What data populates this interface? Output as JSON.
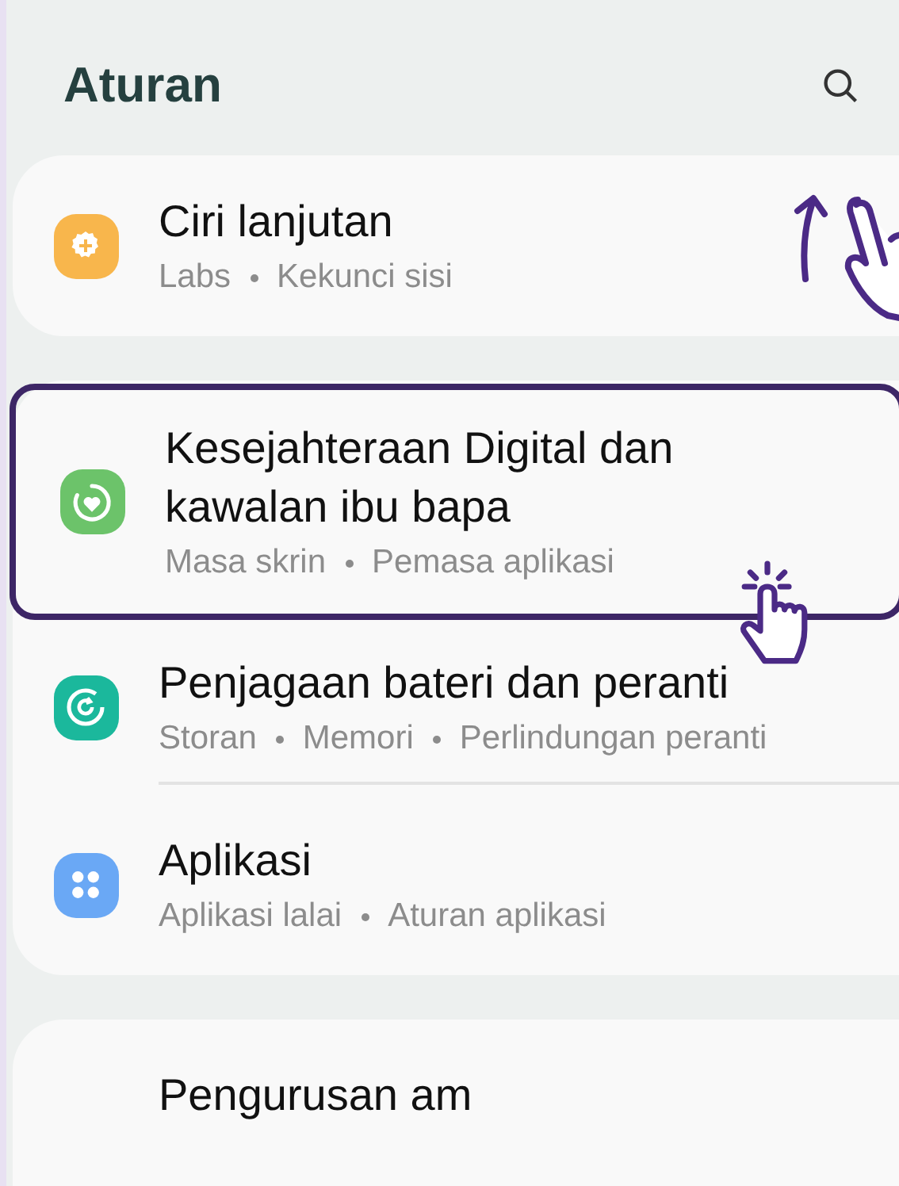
{
  "header": {
    "title": "Aturan"
  },
  "groups": [
    {
      "items": [
        {
          "title": "Ciri lanjutan",
          "subtitles": [
            "Labs",
            "Kekunci sisi"
          ],
          "color": "#f8b64c",
          "highlighted": false
        }
      ]
    },
    {
      "items": [
        {
          "title": "Kesejahteraan Digital dan kawalan ibu bapa",
          "subtitles": [
            "Masa skrin",
            "Pemasa aplikasi"
          ],
          "color": "#6cc36a",
          "highlighted": true
        },
        {
          "title": "Penjagaan bateri dan peranti",
          "subtitles": [
            "Storan",
            "Memori",
            "Perlindungan peranti"
          ],
          "color": "#1bb89c",
          "highlighted": false
        },
        {
          "title": "Aplikasi",
          "subtitles": [
            "Aplikasi lalai",
            "Aturan aplikasi"
          ],
          "color": "#6aa8f5",
          "highlighted": false
        }
      ]
    },
    {
      "items": [
        {
          "title": "Pengurusan am"
        }
      ]
    }
  ]
}
